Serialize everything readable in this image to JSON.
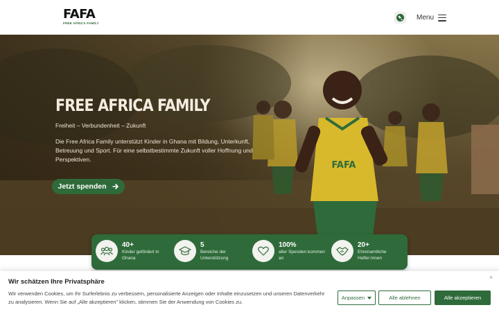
{
  "header": {
    "logo_word": "FAFA",
    "logo_sub": "FREE AFRICA FAMILY",
    "globe_icon": "globe-icon",
    "menu_label": "Menu",
    "menu_icon": "hamburger-icon"
  },
  "hero": {
    "title": "FREE AFRICA FAMILY",
    "tagline": "Freiheit – Verbundenheit – Zukunft",
    "text": "Die Free Africa Family unterstützt Kinder in Ghana mit Bildung, Unterkunft, Betreuung und Sport. Für eine selbstbestimmte Zukunft voller Hoffnung und Perspektiven.",
    "cta_label": "Jetzt spenden",
    "cta_icon": "arrow-right-icon",
    "jersey_label": "FAFA"
  },
  "stats": [
    {
      "number": "40+",
      "label": "Kinder gefördert in Ghana",
      "icon": "people-icon"
    },
    {
      "number": "5",
      "label": "Bereiche der Unterstützung",
      "icon": "graduation-cap-icon"
    },
    {
      "number": "100%",
      "label": "aller Spenden kommen an",
      "icon": "heart-icon"
    },
    {
      "number": "20+",
      "label": "Ehrenamtliche Helfer:innen",
      "icon": "handshake-icon"
    }
  ],
  "cookie": {
    "title": "Wir schätzen Ihre Privatsphäre",
    "text": "Wir verwenden Cookies, um Ihr Surferlebnis zu verbessern, personalisierte Anzeigen oder Inhalte einzusetzen und unseren Datenverkehr zu analysieren. Wenn Sie auf „Alle akzeptieren\" klicken, stimmen Sie der Anwendung von Cookies zu.",
    "close_label": "×",
    "customize_label": "Anpassen",
    "reject_label": "Alle ablehnen",
    "accept_label": "Alle akzeptieren"
  },
  "colors": {
    "brand_green": "#2f6b3a",
    "jersey_yellow": "#d9b92c"
  }
}
